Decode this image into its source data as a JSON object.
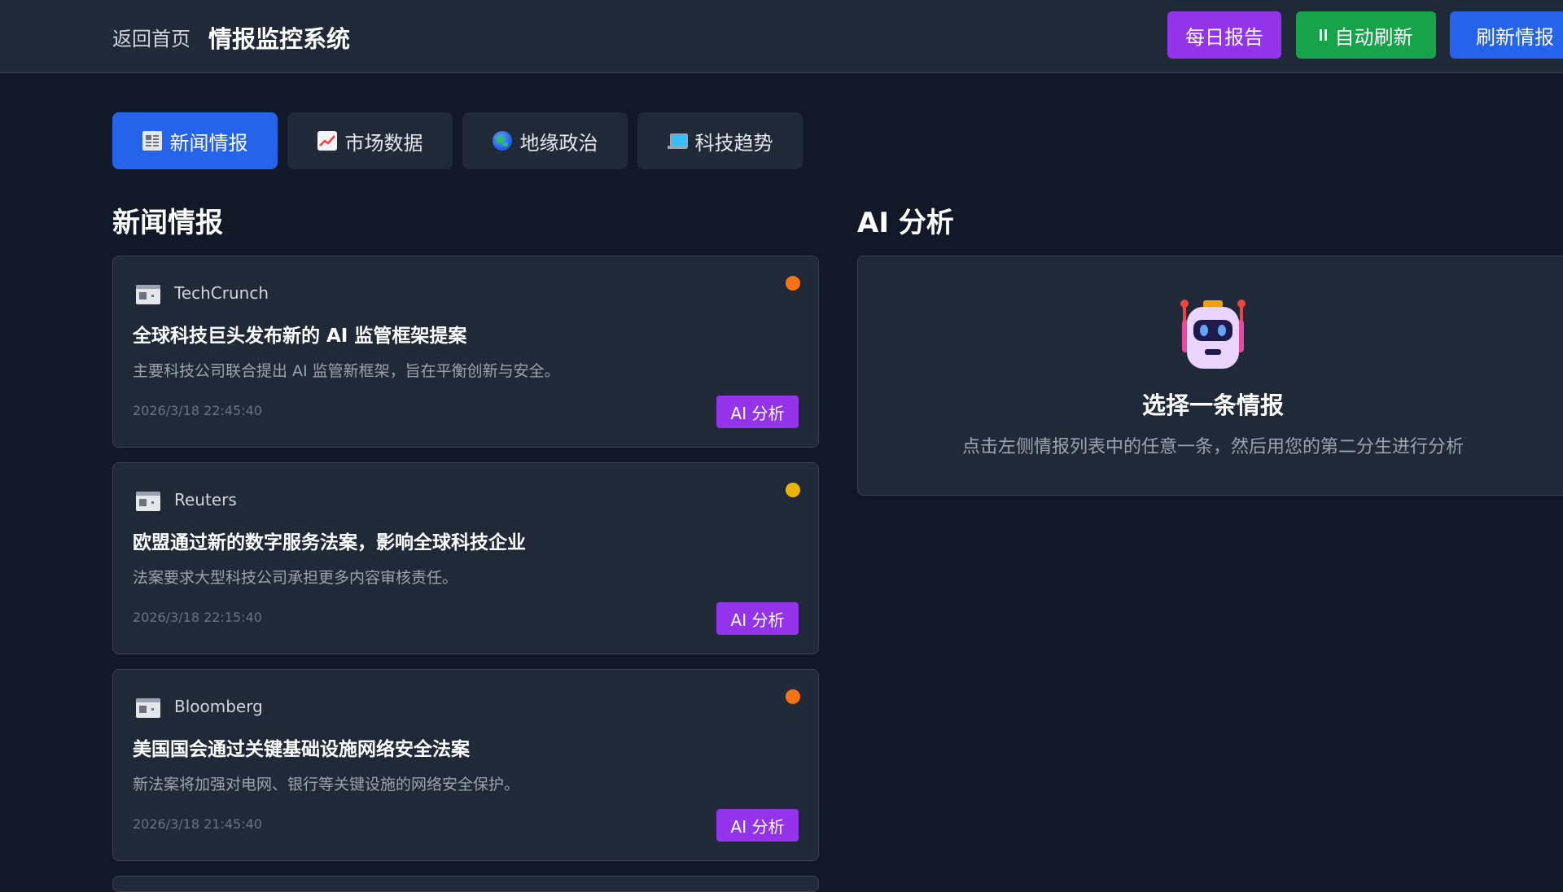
{
  "header": {
    "back_label": "返回首页",
    "title": "情报监控系统",
    "buttons": {
      "daily_report": "每日报告",
      "auto_refresh": "自动刷新",
      "refresh": "刷新情报"
    }
  },
  "tabs": [
    {
      "label": "新闻情报",
      "icon": "newspaper-icon",
      "active": true
    },
    {
      "label": "市场数据",
      "icon": "chart-icon",
      "active": false
    },
    {
      "label": "地缘政治",
      "icon": "globe-icon",
      "active": false
    },
    {
      "label": "科技趋势",
      "icon": "laptop-icon",
      "active": false
    }
  ],
  "news": {
    "section_title": "新闻情报",
    "items": [
      {
        "source": "TechCrunch",
        "headline": "全球科技巨头发布新的 AI 监管框架提案",
        "summary": "主要科技公司联合提出 AI 监管新框架，旨在平衡创新与安全。",
        "time": "2026/3/18 22:45:40",
        "priority_color": "#f97316",
        "button": "AI 分析"
      },
      {
        "source": "Reuters",
        "headline": "欧盟通过新的数字服务法案，影响全球科技企业",
        "summary": "法案要求大型科技公司承担更多内容审核责任。",
        "time": "2026/3/18 22:15:40",
        "priority_color": "#eab308",
        "button": "AI 分析"
      },
      {
        "source": "Bloomberg",
        "headline": "美国国会通过关键基础设施网络安全法案",
        "summary": "新法案将加强对电网、银行等关键设施的网络安全保护。",
        "time": "2026/3/18 21:45:40",
        "priority_color": "#f97316",
        "button": "AI 分析"
      }
    ]
  },
  "ai": {
    "section_title": "AI 分析",
    "icon": "robot-icon",
    "heading": "选择一条情报",
    "description": "点击左侧情报列表中的任意一条，然后用您的第二分生进行分析"
  },
  "colors": {
    "background": "#111827",
    "panel": "#1f2937",
    "accent_blue": "#2563eb",
    "accent_purple": "#9333ea",
    "accent_green": "#16a34a"
  }
}
